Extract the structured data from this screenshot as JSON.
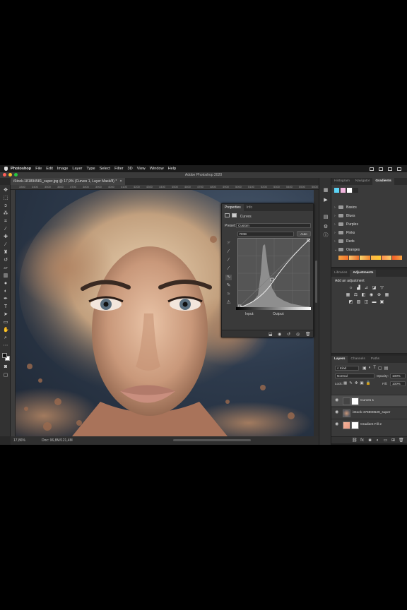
{
  "menubar": {
    "items": [
      "Photoshop",
      "File",
      "Edit",
      "Image",
      "Layer",
      "Type",
      "Select",
      "Filter",
      "3D",
      "View",
      "Window",
      "Help"
    ]
  },
  "window": {
    "title": "Adobe Photoshop 2020"
  },
  "document": {
    "tab_label": "iStock-181894581_super.jpg @ 17,9% (Curves 1, Layer Mask/8) *",
    "zoom": "17,86%",
    "doc_info": "Doc: 96,8M/121,4M"
  },
  "ruler": {
    "ticks": [
      "3300",
      "3400",
      "3500",
      "3600",
      "3700",
      "3800",
      "3900",
      "4000",
      "4100",
      "4200",
      "4300",
      "4400",
      "4500",
      "4600",
      "4700",
      "4800",
      "4900",
      "5000",
      "5100",
      "5200",
      "5300",
      "5400",
      "5500",
      "5600"
    ]
  },
  "properties": {
    "tabs": [
      "Properties",
      "Info"
    ],
    "type_label": "Curves",
    "preset_label": "Preset:",
    "preset_value": "Custom",
    "channel_value": "RGB",
    "auto_label": "Auto",
    "input_label": "Input:",
    "output_label": "Output:"
  },
  "gradients_panel": {
    "tabs": [
      "Histogram",
      "Navigator",
      "Gradients"
    ],
    "swatch_colors": [
      "#5bd3f5",
      "#f0b4dc",
      "#ffffff",
      "#2a2a2a"
    ],
    "folders": [
      "Basics",
      "Blues",
      "Purples",
      "Pinks",
      "Reds",
      "Oranges"
    ]
  },
  "adjustments_panel": {
    "tabs": [
      "Libraries",
      "Adjustments"
    ],
    "add_label": "Add an adjustment"
  },
  "layers_panel": {
    "tabs": [
      "Layers",
      "Channels",
      "Paths"
    ],
    "kind_label": "Kind",
    "blend_mode": "Normal",
    "opacity_label": "Opacity:",
    "opacity_value": "100%",
    "lock_label": "Lock:",
    "fill_label": "Fill:",
    "fill_value": "100%",
    "layers": [
      {
        "name": "Curves 1",
        "selected": true
      },
      {
        "name": "iStock-475900629_super",
        "selected": false
      },
      {
        "name": "Gradient Fill 2",
        "selected": false
      }
    ]
  },
  "icons": {
    "toolbar": [
      "move-icon",
      "marquee-icon",
      "lasso-icon",
      "magic-wand-icon",
      "crop-icon",
      "eyedropper-icon",
      "healing-brush-icon",
      "brush-icon",
      "clone-stamp-icon",
      "history-brush-icon",
      "eraser-icon",
      "gradient-icon",
      "blur-icon",
      "dodge-icon",
      "pen-icon",
      "type-icon",
      "path-select-icon",
      "rectangle-icon",
      "hand-icon",
      "zoom-icon",
      "more-tools-icon"
    ]
  }
}
